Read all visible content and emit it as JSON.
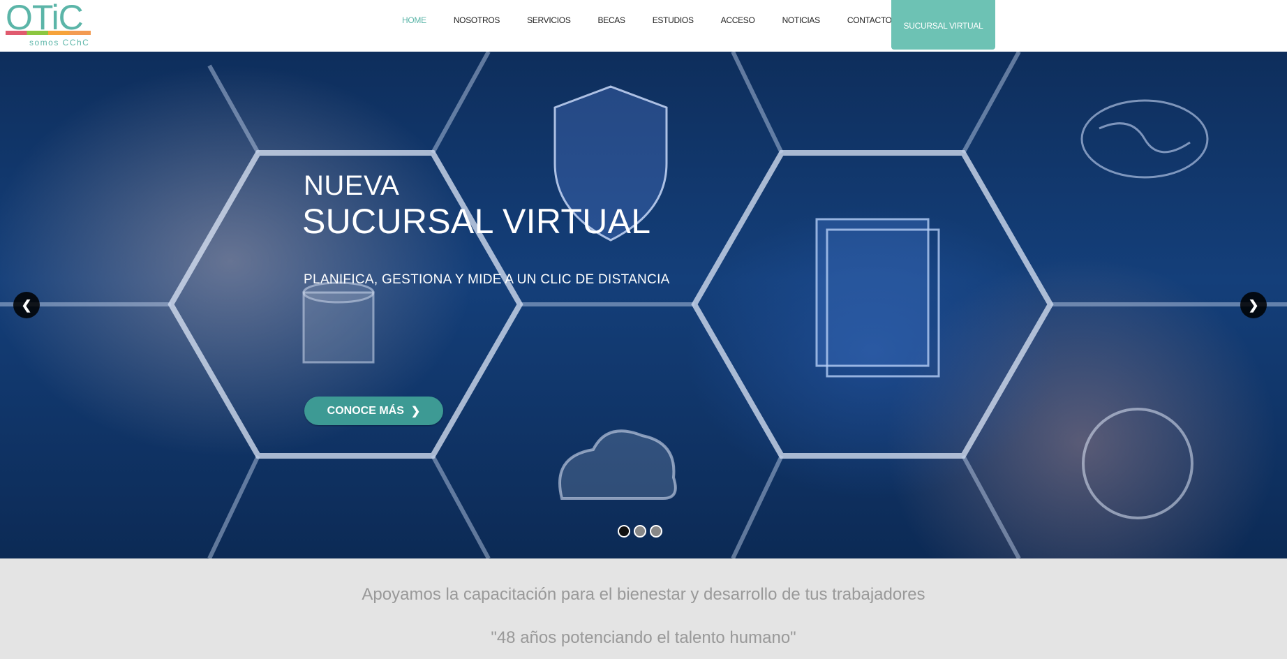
{
  "brand": {
    "logo_text": "OTiC",
    "logo_sub": "somos CChC"
  },
  "nav": {
    "items": [
      {
        "label": "HOME",
        "active": true
      },
      {
        "label": "NOSOTROS"
      },
      {
        "label": "SERVICIOS"
      },
      {
        "label": "BECAS"
      },
      {
        "label": "ESTUDIOS"
      },
      {
        "label": "ACCESO"
      },
      {
        "label": "NOTICIAS"
      },
      {
        "label": "CONTACTO"
      }
    ],
    "cta_label": "SUCURSAL VIRTUAL"
  },
  "hero": {
    "title_line1": "NUEVA",
    "title_line2": "SUCURSAL VIRTUAL",
    "subtitle": "PLANIFICA, GESTIONA Y MIDE A UN CLIC DE DISTANCIA",
    "cta_label": "CONOCE MÁS",
    "slides_total": 3,
    "active_slide": 1
  },
  "intro": {
    "line1": "Apoyamos la capacitación para el bienestar y desarrollo de tus trabajadores",
    "line2": "\"48 años potenciando el talento humano\""
  },
  "colors": {
    "accent": "#6dc2b4",
    "nav_active": "#5bb5a8",
    "hero_button": "#3d9a94",
    "intro_bg": "#e4e4e4",
    "intro_text": "#999999"
  }
}
